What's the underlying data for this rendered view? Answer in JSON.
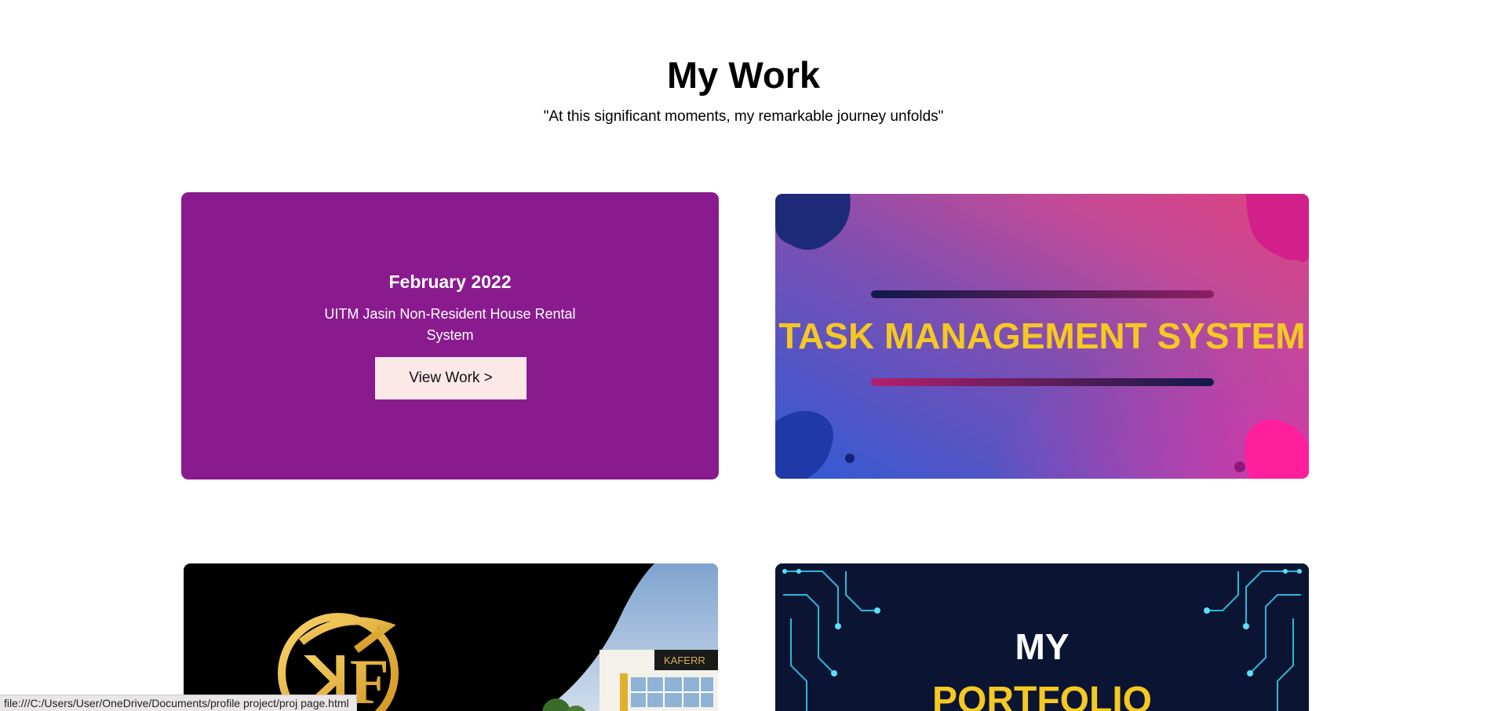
{
  "section": {
    "title": "My Work",
    "subtitle": "\"At this significant moments, my remarkable journey unfolds\""
  },
  "cards": [
    {
      "date": "February 2022",
      "description": "UITM Jasin Non-Resident House Rental System",
      "button_label": "View Work >",
      "color": "#8a1b8e"
    },
    {
      "image_text": "TASK MANAGEMENT SYSTEM"
    },
    {
      "image_text": "KAFERR"
    },
    {
      "image_text_line1": "MY",
      "image_text_line2": "PORTFOLIO"
    }
  ],
  "status_bar": {
    "url": "file:///C:/Users/User/OneDrive/Documents/profile project/proj page.html"
  }
}
